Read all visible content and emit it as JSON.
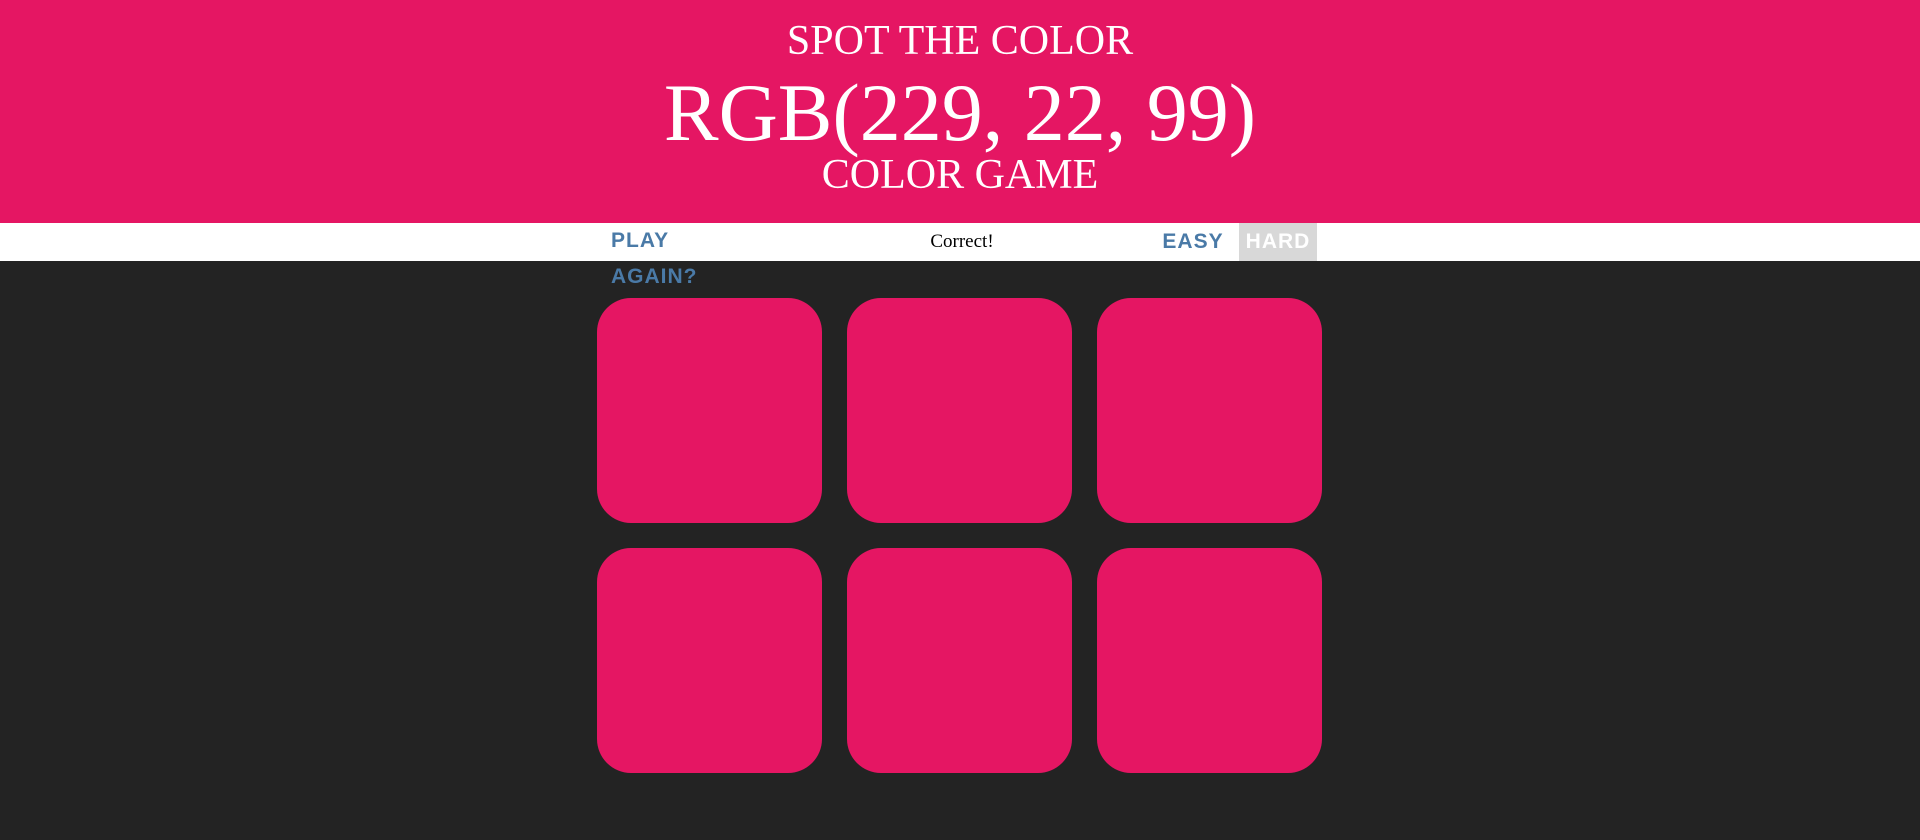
{
  "header": {
    "line1": "SPOT THE COLOR",
    "rgb_display": "RGB(229, 22, 99)",
    "line3": "COLOR GAME",
    "background_color": "#e51663"
  },
  "controls": {
    "reset_label": "PLAY AGAIN?",
    "message": "Correct!",
    "easy_label": "EASY",
    "hard_label": "HARD",
    "selected_mode": "hard",
    "accent_color": "#4a7aa7"
  },
  "squares": [
    {
      "color": "#e51663"
    },
    {
      "color": "#e51663"
    },
    {
      "color": "#e51663"
    },
    {
      "color": "#e51663"
    },
    {
      "color": "#e51663"
    },
    {
      "color": "#e51663"
    }
  ],
  "page_background": "#232323"
}
